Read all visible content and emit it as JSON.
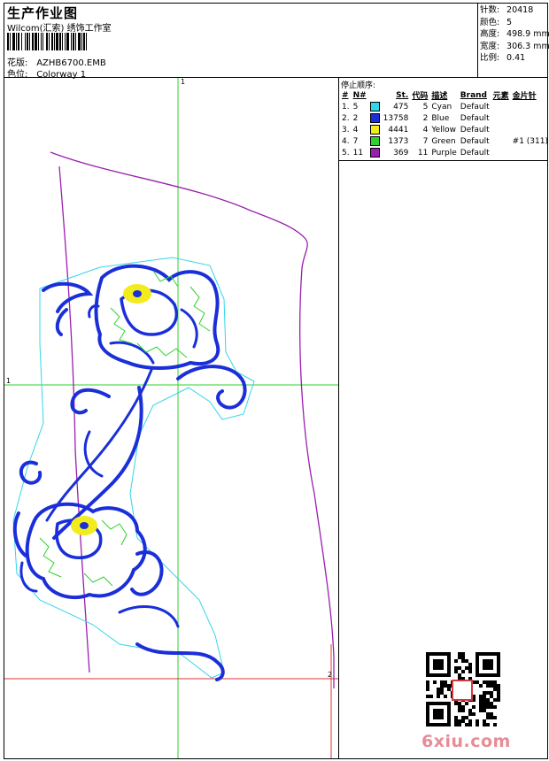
{
  "header": {
    "title": "生产作业图",
    "company": "Wilcom(汇索) 绣饰工作室",
    "design_label": "花版:",
    "design_value": "AZHB6700.EMB",
    "colorway_label": "色位:",
    "colorway_value": "Colorway 1"
  },
  "stats": [
    {
      "label": "针数:",
      "value": "20418"
    },
    {
      "label": "颜色:",
      "value": "5"
    },
    {
      "label": "高度:",
      "value": "498.9 mm"
    },
    {
      "label": "宽度:",
      "value": "306.3 mm"
    },
    {
      "label": "比例:",
      "value": "0.41"
    }
  ],
  "stops": {
    "title": "停止顺序:",
    "columns": [
      "#",
      "N#",
      "St.",
      "代码",
      "描述",
      "Brand",
      "元素",
      "金片针"
    ],
    "rows": [
      {
        "index": "1.",
        "needle": "5",
        "color": "#33d6e8",
        "stitches": "475",
        "code": "5",
        "desc": "Cyan",
        "brand": "Default",
        "element": "",
        "sequin": ""
      },
      {
        "index": "2.",
        "needle": "2",
        "color": "#1a2fd9",
        "stitches": "13758",
        "code": "2",
        "desc": "Blue",
        "brand": "Default",
        "element": "",
        "sequin": ""
      },
      {
        "index": "3.",
        "needle": "4",
        "color": "#f2ec1c",
        "stitches": "4441",
        "code": "4",
        "desc": "Yellow",
        "brand": "Default",
        "element": "",
        "sequin": ""
      },
      {
        "index": "4.",
        "needle": "7",
        "color": "#2fd12f",
        "stitches": "1373",
        "code": "7",
        "desc": "Green",
        "brand": "Default",
        "element": "",
        "sequin": "#1 (311)"
      },
      {
        "index": "5.",
        "needle": "11",
        "color": "#9a1fb0",
        "stitches": "369",
        "code": "11",
        "desc": "Purple",
        "brand": "Default",
        "element": "",
        "sequin": ""
      }
    ]
  },
  "canvas": {
    "axis_top": "1",
    "axis_left": "1",
    "axis_right": "2"
  },
  "watermark": "6xiu.com",
  "colors": {
    "guide_green": "#2fd12f",
    "guide_red": "#e03030",
    "outline_cyan": "#33d6e8",
    "fill_blue": "#1a2fd9",
    "accent_yellow": "#f2ec1c",
    "purple": "#9a1fb0"
  }
}
